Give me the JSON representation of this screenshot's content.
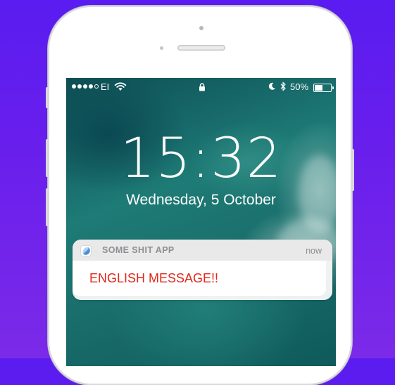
{
  "status_bar": {
    "carrier": "EI",
    "battery": "50%",
    "battery_level": 0.5,
    "signal_bars_filled": 4,
    "signal_bars_total": 5
  },
  "lock_screen": {
    "time": "15:32",
    "date": "Wednesday, 5 October"
  },
  "notification": {
    "app_name": "SOME SHIT APP",
    "time": "now",
    "message": "ENGLISH MESSAGE!!"
  },
  "colors": {
    "background": "#6a1fec",
    "message_text": "#e0281a",
    "header_text": "#8e8e93"
  }
}
